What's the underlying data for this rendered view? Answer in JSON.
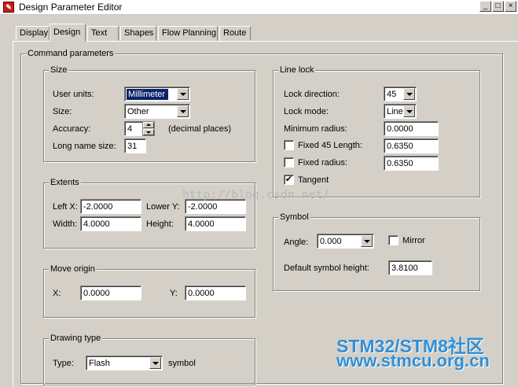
{
  "window": {
    "title": "Design Parameter Editor"
  },
  "tabs": [
    {
      "label": "Display",
      "active": false
    },
    {
      "label": "Design",
      "active": true
    },
    {
      "label": "Text",
      "active": false
    },
    {
      "label": "Shapes",
      "active": false
    },
    {
      "label": "Flow Planning",
      "active": false
    },
    {
      "label": "Route",
      "active": false
    }
  ],
  "command_parameters": {
    "title": "Command parameters",
    "size": {
      "title": "Size",
      "user_units_label": "User units:",
      "user_units_value": "Millimeter",
      "size_label": "Size:",
      "size_value": "Other",
      "accuracy_label": "Accuracy:",
      "accuracy_value": "4",
      "accuracy_suffix": "(decimal places)",
      "long_name_label": "Long name size:",
      "long_name_value": "31"
    },
    "extents": {
      "title": "Extents",
      "left_x_label": "Left X:",
      "left_x_value": "-2.0000",
      "lower_y_label": "Lower Y:",
      "lower_y_value": "-2.0000",
      "width_label": "Width:",
      "width_value": "4.0000",
      "height_label": "Height:",
      "height_value": "4.0000"
    },
    "move_origin": {
      "title": "Move origin",
      "x_label": "X:",
      "x_value": "0.0000",
      "y_label": "Y:",
      "y_value": "0.0000"
    },
    "drawing_type": {
      "title": "Drawing type",
      "type_label": "Type:",
      "type_value": "Flash",
      "suffix": "symbol"
    },
    "line_lock": {
      "title": "Line lock",
      "lock_direction_label": "Lock direction:",
      "lock_direction_value": "45",
      "lock_mode_label": "Lock mode:",
      "lock_mode_value": "Line",
      "min_radius_label": "Minimum radius:",
      "min_radius_value": "0.0000",
      "fixed45_label": "Fixed 45 Length:",
      "fixed45_value": "0.6350",
      "fixed45_checked": false,
      "fixed_radius_label": "Fixed radius:",
      "fixed_radius_value": "0.6350",
      "fixed_radius_checked": false,
      "tangent_label": "Tangent",
      "tangent_checked": true
    },
    "symbol": {
      "title": "Symbol",
      "angle_label": "Angle:",
      "angle_value": "0.000",
      "mirror_label": "Mirror",
      "mirror_checked": false,
      "default_height_label": "Default symbol height:",
      "default_height_value": "3.8100"
    }
  },
  "overlays": {
    "watermark": "http://blog.csdn.net/",
    "brand_line1": "STM32/STM8社区",
    "brand_line2": "www.stmcu.org.cn"
  },
  "colors": {
    "selection": "#0a246a",
    "brand": "#2f8fd8",
    "face": "#d4d0c8"
  }
}
